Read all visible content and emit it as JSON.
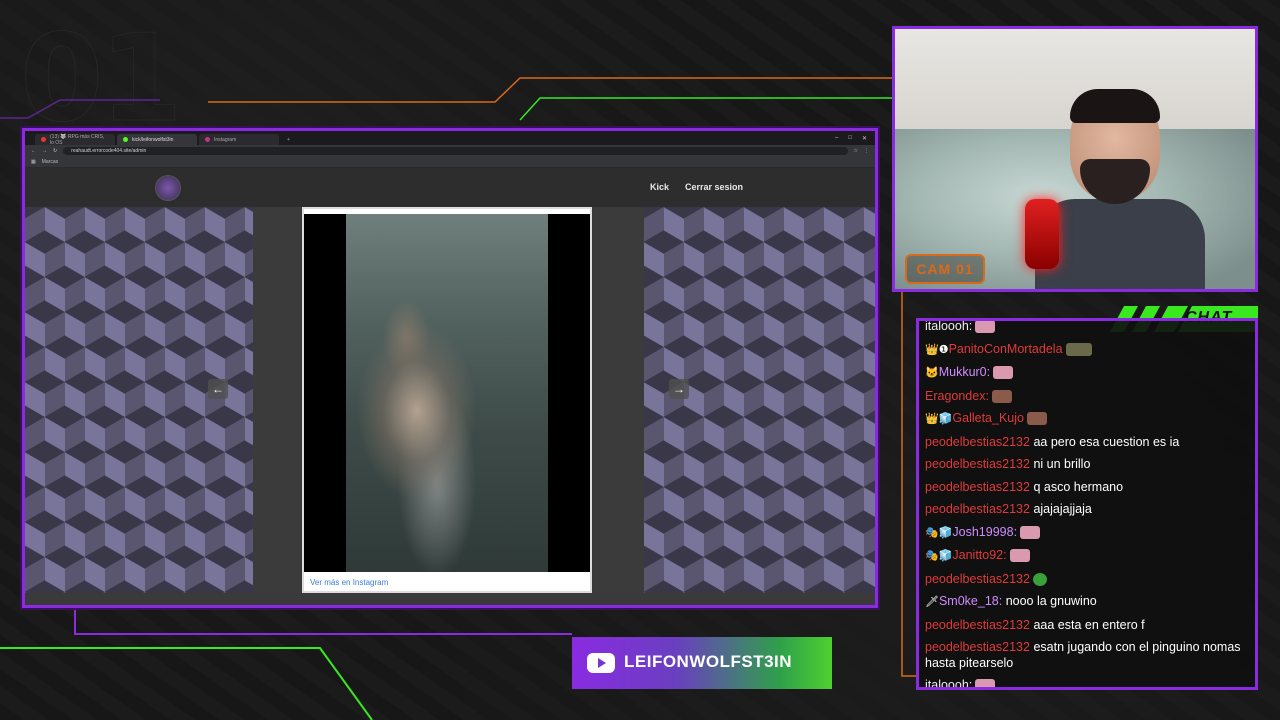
{
  "overlay": {
    "big_number": "01",
    "cam_label": "CAM 01",
    "chat_label": "CHAT",
    "channel_name": "LEIFONWOLFST3IN",
    "accent_purple": "#8a2be2",
    "accent_green": "#39e81f",
    "accent_orange": "#d96a1a"
  },
  "browser": {
    "tabs": [
      {
        "label": "(13) 🐺 RPG más CRIS, lo OS",
        "icon": "record-dot-icon"
      },
      {
        "label": "kick/leifonwolfst3in",
        "icon": "kick-icon"
      },
      {
        "label": "Instagram",
        "icon": "instagram-icon"
      }
    ],
    "url": "reahaudt.errorcode404.site/admin",
    "bookmark": "Marcas",
    "site": {
      "nav_kick": "Kick",
      "nav_logout": "Cerrar sesion",
      "ig_link": "Ver más en Instagram"
    }
  },
  "chat": {
    "messages": [
      {
        "user": "italoooh:",
        "text": "",
        "user_color": "white",
        "badges": "",
        "emote": "cat"
      },
      {
        "user": "PanitoConMortadela",
        "text": "",
        "user_color": "red",
        "badges": "👑❶",
        "emote": "olive"
      },
      {
        "user": "Mukkur0:",
        "text": "",
        "user_color": "purple",
        "badges": "🐱",
        "emote": "pink"
      },
      {
        "user": "Eragondex:",
        "text": "",
        "user_color": "red",
        "badges": "",
        "emote": "brown"
      },
      {
        "user": "Galleta_Kujo",
        "text": "",
        "user_color": "red",
        "badges": "👑🧊",
        "emote": "brown"
      },
      {
        "user": "peodelbestias2132",
        "text": "aa pero esa cuestion es ia",
        "user_color": "red",
        "badges": "",
        "emote": ""
      },
      {
        "user": "peodelbestias2132",
        "text": "ni un brillo",
        "user_color": "red",
        "badges": "",
        "emote": ""
      },
      {
        "user": "peodelbestias2132",
        "text": "q asco hermano",
        "user_color": "red",
        "badges": "",
        "emote": ""
      },
      {
        "user": "peodelbestias2132",
        "text": "ajajajajjaja",
        "user_color": "red",
        "badges": "",
        "emote": ""
      },
      {
        "user": "Josh19998:",
        "text": "",
        "user_color": "purple",
        "badges": "🎭🧊",
        "emote": "pink"
      },
      {
        "user": "Janitto92:",
        "text": "",
        "user_color": "red",
        "badges": "🎭🧊",
        "emote": "pink"
      },
      {
        "user": "peodelbestias2132",
        "text": "",
        "user_color": "red",
        "badges": "",
        "emote": "frog"
      },
      {
        "user": "Sm0ke_18:",
        "text": "nooo la gnuwino",
        "user_color": "purple",
        "badges": "🗡",
        "emote": ""
      },
      {
        "user": "peodelbestias2132",
        "text": "aaa esta en entero f",
        "user_color": "red",
        "badges": "",
        "emote": ""
      },
      {
        "user": "peodelbestias2132",
        "text": "esatn jugando con el pinguino nomas hasta pitearselo",
        "user_color": "red",
        "badges": "",
        "emote": ""
      },
      {
        "user": "italoooh:",
        "text": "",
        "user_color": "white",
        "badges": "",
        "emote": "cat"
      }
    ]
  }
}
